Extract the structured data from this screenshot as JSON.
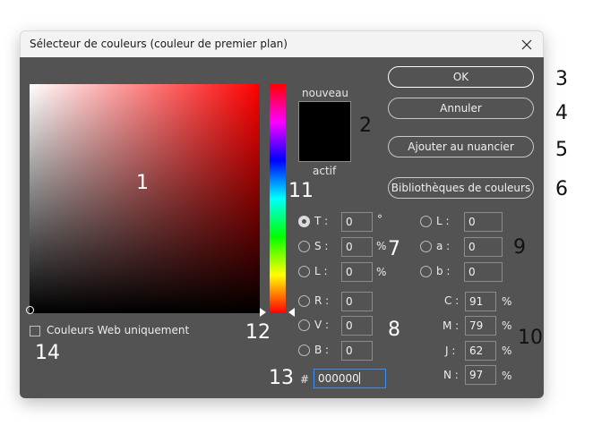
{
  "window": {
    "title": "Sélecteur de couleurs (couleur de premier plan)",
    "close_icon": "close-icon"
  },
  "swatches": {
    "new_label": "nouveau",
    "current_label": "actif",
    "new_color": "#000000"
  },
  "buttons": {
    "ok": "OK",
    "cancel": "Annuler",
    "add_swatch": "Ajouter au nuancier",
    "libraries": "Bibliothèques de couleurs"
  },
  "hsl": [
    {
      "label": "T :",
      "value": "0",
      "unit": "°",
      "checked": true
    },
    {
      "label": "S :",
      "value": "0",
      "unit": "%",
      "checked": false
    },
    {
      "label": "L :",
      "value": "0",
      "unit": "%",
      "checked": false
    }
  ],
  "lab": [
    {
      "label": "L :",
      "value": "0"
    },
    {
      "label": "a :",
      "value": "0"
    },
    {
      "label": "b :",
      "value": "0"
    }
  ],
  "rgb": [
    {
      "label": "R :",
      "value": "0"
    },
    {
      "label": "V :",
      "value": "0"
    },
    {
      "label": "B :",
      "value": "0"
    }
  ],
  "cmyk": [
    {
      "label": "C :",
      "value": "91",
      "unit": "%"
    },
    {
      "label": "M :",
      "value": "79",
      "unit": "%"
    },
    {
      "label": "J :",
      "value": "62",
      "unit": "%"
    },
    {
      "label": "N :",
      "value": "97",
      "unit": "%"
    }
  ],
  "hex": {
    "label": "#",
    "value": "000000"
  },
  "web_only": {
    "label": "Couleurs Web uniquement",
    "checked": false
  },
  "callouts": [
    "1",
    "2",
    "3",
    "4",
    "5",
    "6",
    "7",
    "8",
    "9",
    "10",
    "11",
    "12",
    "13",
    "14"
  ]
}
